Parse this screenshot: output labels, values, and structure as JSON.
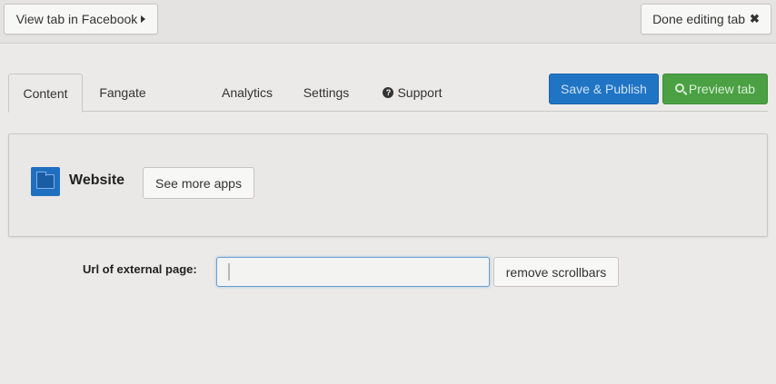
{
  "topbar": {
    "view_tab_label": "View tab in Facebook",
    "done_editing_label": "Done editing tab"
  },
  "tabs": [
    {
      "label": "Content",
      "active": true
    },
    {
      "label": "Fangate",
      "active": false
    },
    {
      "label": "Analytics",
      "active": false
    },
    {
      "label": "Settings",
      "active": false
    },
    {
      "label": "Support",
      "active": false,
      "icon": "question-circle-icon"
    }
  ],
  "actions": {
    "save_label": "Save & Publish",
    "preview_label": "Preview tab",
    "save_color": "#1f74c4",
    "preview_color": "#4aa043"
  },
  "app": {
    "icon": "folder-icon",
    "title": "Website",
    "see_more_label": "See more apps"
  },
  "form": {
    "url_label": "Url of external page:",
    "url_value": "",
    "remove_scrollbars_label": "remove scrollbars"
  }
}
